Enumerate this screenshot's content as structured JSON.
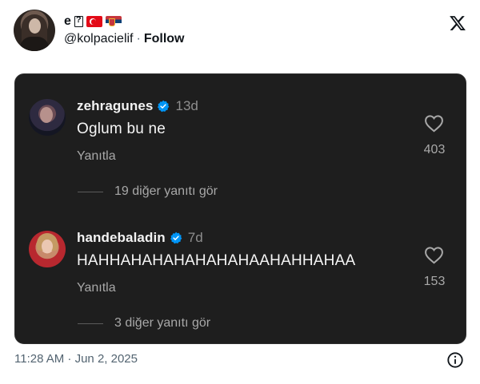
{
  "tweet": {
    "author": {
      "name": "e",
      "name_glyph": "?",
      "flags": [
        "turkey-flag",
        "serbia-flag"
      ],
      "handle": "@kolpacielif",
      "separator": "·",
      "follow_label": "Follow"
    },
    "platform_icon": "x-logo-icon",
    "timestamp": "11:28 AM · Jun 2, 2025",
    "info_icon": "info-icon"
  },
  "screenshot": {
    "background": "#1e1e1e",
    "comments": [
      {
        "username": "zehragunes",
        "verified": true,
        "time": "13d",
        "text": "Oglum bu ne",
        "reply_label": "Yanıtla",
        "more_replies": "19 diğer yanıtı gör",
        "likes": "403"
      },
      {
        "username": "handebaladin",
        "verified": true,
        "time": "7d",
        "text": "HAHHAHAHAHAHAHAHAAHAHHAHAA",
        "reply_label": "Yanıtla",
        "more_replies": "3 diğer yanıtı gör",
        "likes": "153"
      }
    ]
  },
  "colors": {
    "verified_blue": "#0095f6",
    "muted_text": "#a8a8a8",
    "card_bg": "#1e1e1e"
  }
}
